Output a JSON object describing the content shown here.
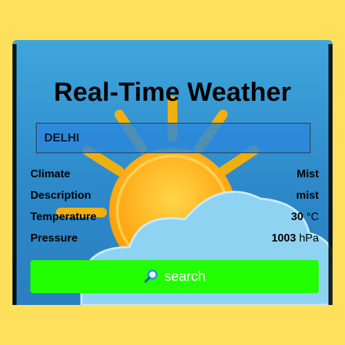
{
  "app": {
    "title": "Real-Time Weather"
  },
  "search": {
    "value": "DELHI",
    "button_label": "search",
    "icon": "magnifier-icon"
  },
  "weather": {
    "rows": [
      {
        "label": "Climate",
        "value": "Mist",
        "unit": ""
      },
      {
        "label": "Description",
        "value": "mist",
        "unit": ""
      },
      {
        "label": "Temperature",
        "value": "30",
        "unit": "°C"
      },
      {
        "label": "Pressure",
        "value": "1003",
        "unit": "hPa"
      }
    ]
  },
  "colors": {
    "page_background": "#ffe05c",
    "card_background": "#3fa6dc",
    "button": "#22ff00",
    "sun": "#ffb300",
    "cloud": "#8fd3f2"
  }
}
